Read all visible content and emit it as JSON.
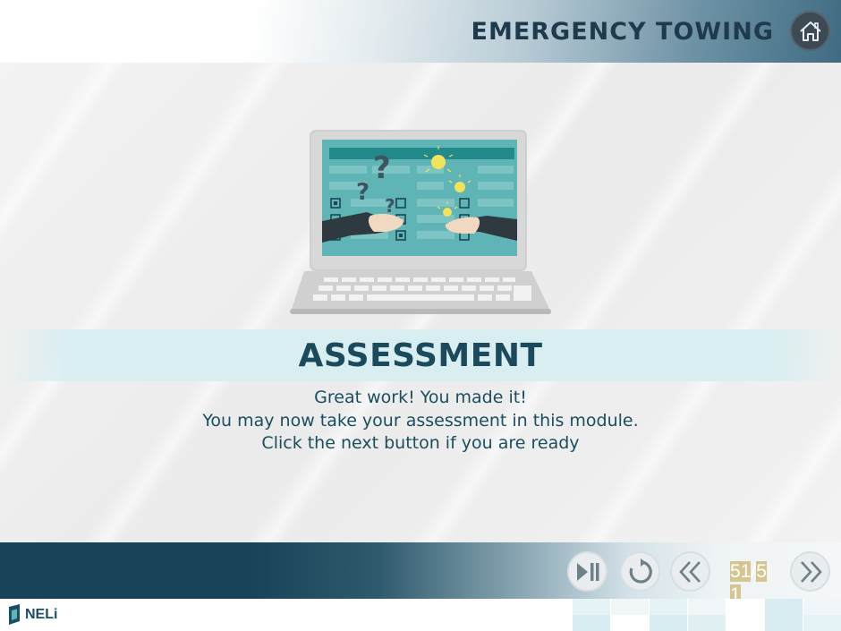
{
  "header": {
    "title": "EMERGENCY TOWING",
    "home_icon": "home-icon"
  },
  "content": {
    "heading": "ASSESSMENT",
    "lines": [
      "Great work! You made it!",
      "You may now take your assessment in this module.",
      "Click the next button if you are ready"
    ],
    "illustration": "laptop-quiz-illustration"
  },
  "controls": {
    "play_pause_icon": "play-pause-icon",
    "replay_icon": "replay-icon",
    "prev_icon": "double-chevron-left-icon",
    "next_icon": "double-chevron-right-icon",
    "page_current": "51",
    "page_separator": "/",
    "page_total_a": "5",
    "page_total_b": "1"
  },
  "footer": {
    "logo_text": "NELi"
  },
  "colors": {
    "header_title": "#1f3a4c",
    "teal_dark": "#174459",
    "heading": "#1b4a5c",
    "banner": "#d9eef1",
    "screen": "#5fb5b6"
  }
}
